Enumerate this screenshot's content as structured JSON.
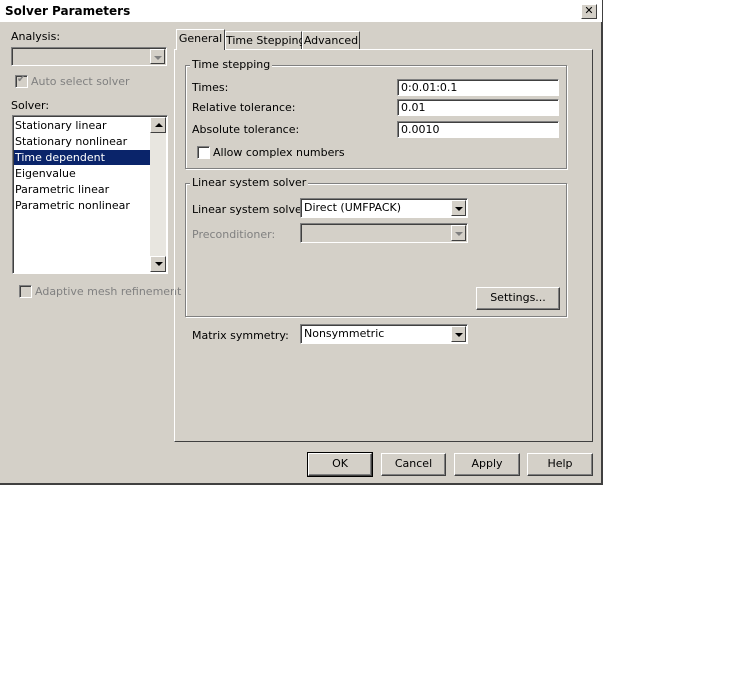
{
  "window": {
    "title": "Solver Parameters",
    "close_glyph": "✕"
  },
  "left": {
    "analysis_label": "Analysis:",
    "analysis_value": "",
    "auto_select_label": "Auto select solver",
    "solver_label": "Solver:",
    "solvers": [
      "Stationary linear",
      "Stationary nonlinear",
      "Time dependent",
      "Eigenvalue",
      "Parametric linear",
      "Parametric nonlinear"
    ],
    "selected_solver": "Time dependent",
    "adaptive_label": "Adaptive mesh refinement"
  },
  "tabs": [
    {
      "label": "General",
      "active": true
    },
    {
      "label": "Time Stepping",
      "active": false
    },
    {
      "label": "Advanced",
      "active": false
    }
  ],
  "time_stepping": {
    "group_title": "Time stepping",
    "times_label": "Times:",
    "times_value": "0:0.01:0.1",
    "reltol_label": "Relative tolerance:",
    "reltol_value": "0.01",
    "abstol_label": "Absolute tolerance:",
    "abstol_value": "0.0010",
    "complex_label": "Allow complex numbers"
  },
  "linear_solver": {
    "group_title": "Linear system solver",
    "solver_label": "Linear system solver:",
    "solver_value": "Direct (UMFPACK)",
    "precond_label": "Preconditioner:",
    "precond_value": "",
    "settings_label": "Settings..."
  },
  "matrix": {
    "label": "Matrix symmetry:",
    "value": "Nonsymmetric"
  },
  "buttons": {
    "ok": "OK",
    "cancel": "Cancel",
    "apply": "Apply",
    "help": "Help"
  },
  "colors": {
    "dialog_bg": "#d4d0c8",
    "selection": "#0a246a"
  }
}
